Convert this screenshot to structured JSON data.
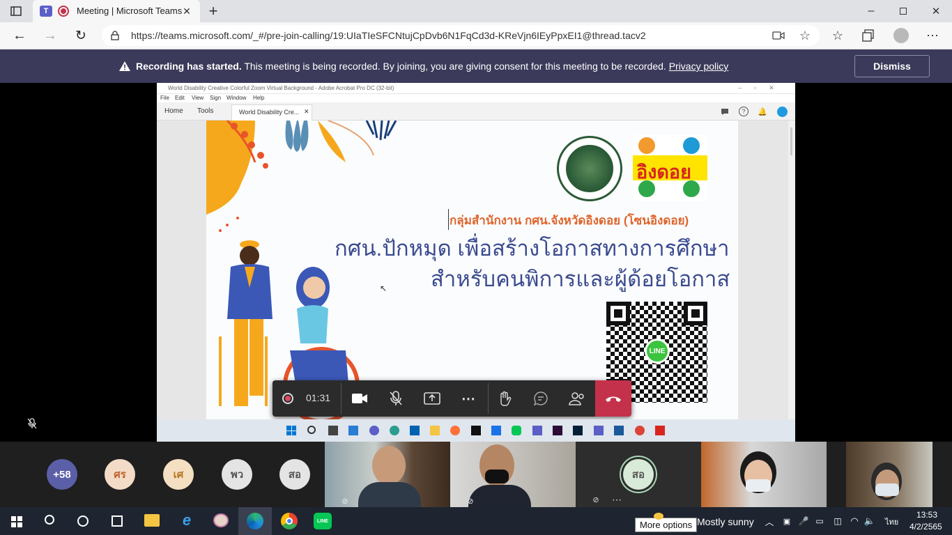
{
  "browser": {
    "tab_title": "Meeting | Microsoft Teams",
    "url": "https://teams.microsoft.com/_#/pre-join-calling/19:UIaTIeSFCNtujCpDvb6N1FqCd3d-KReVjn6IEyPpxEI1@thread.tacv2"
  },
  "banner": {
    "bold": "Recording has started.",
    "text": "This meeting is being recorded. By joining, you are giving consent for this meeting to be recorded.",
    "link": "Privacy policy",
    "dismiss": "Dismiss"
  },
  "acrobat": {
    "title": "World Disability Creative Colorful Zoom Virtual Background - Adobe Acrobat Pro DC (32-bit)",
    "menu": [
      "File",
      "Edit",
      "View",
      "Sign",
      "Window",
      "Help"
    ],
    "tab_home": "Home",
    "tab_tools": "Tools",
    "tab_doc": "World Disability Cre..."
  },
  "slide": {
    "logo_text": "อิงดอย",
    "org": "กลุ่มสำนักงาน กศน.จังหวัดอิงดอย (โซนอิงดอย)",
    "headline1": "กศน.ปักหมุด เพื่อสร้างโอกาสทางการศึกษา",
    "headline2": "สำหรับคนพิการและผู้ด้อยโอกาส",
    "qr_badge": "LINE"
  },
  "callbar": {
    "timer": "01:31"
  },
  "participants": {
    "overflow": "+58",
    "initials": [
      "ศร",
      "เศ",
      "พว",
      "สอ",
      "สอ"
    ]
  },
  "taskbar": {
    "tooltip": "More options",
    "weather": "Mostly sunny",
    "lang": "ไทย",
    "time": "13:53",
    "date": "4/2/2565"
  },
  "colors": {
    "banner": "#3b3a5a",
    "hangup": "#c4314b",
    "slide_headline": "#3a4a8f",
    "slide_org": "#e0642a"
  }
}
